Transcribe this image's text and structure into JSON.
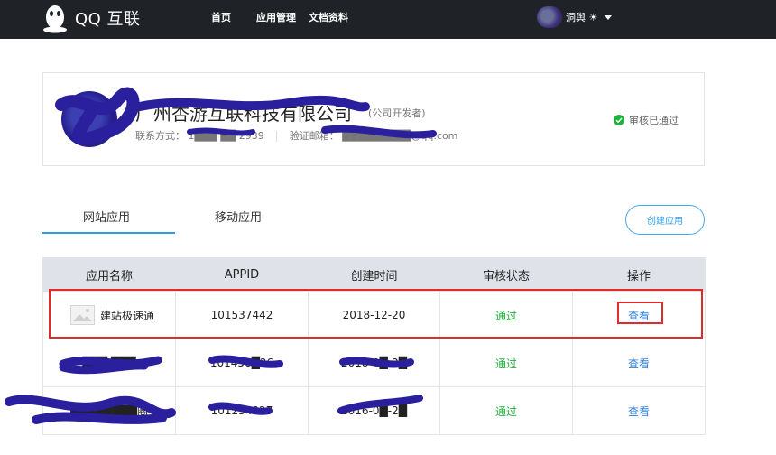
{
  "header": {
    "logo_text": "QQ 互联",
    "nav": [
      "首页",
      "应用管理",
      "文档资料"
    ],
    "user_name": "洞舆 ☀"
  },
  "company": {
    "name": "广州杏游互联科技有限公司",
    "role": "(公司开发者)",
    "contact_label": "联系方式：",
    "contact_value": "1███ ██ 2939",
    "email_label": "验证邮箱：",
    "email_value": "█████████@qq.com",
    "status": "审核已通过"
  },
  "tabs": {
    "web": "网站应用",
    "mobile": "移动应用"
  },
  "create_button": "创建应用",
  "table": {
    "headers": [
      "应用名称",
      "APPID",
      "创建时间",
      "审核状态",
      "操作"
    ],
    "rows": [
      {
        "name": "建站极速通",
        "appid": "101537442",
        "created": "2018-12-20",
        "status": "通过",
        "action": "查看"
      },
      {
        "name": "███ ███",
        "appid": "101456█26",
        "created": "2018-0█-2█",
        "status": "通过",
        "action": "查看"
      },
      {
        "name": "████████圈",
        "appid": "101254027",
        "created": "2016-0█-2█",
        "status": "通过",
        "action": "查看"
      }
    ]
  },
  "colors": {
    "topbar": "#1f2328",
    "accent": "#2f9be8",
    "pass": "#1eb23a",
    "highlight": "#e02b2b",
    "scribble": "#2a1f9c"
  }
}
